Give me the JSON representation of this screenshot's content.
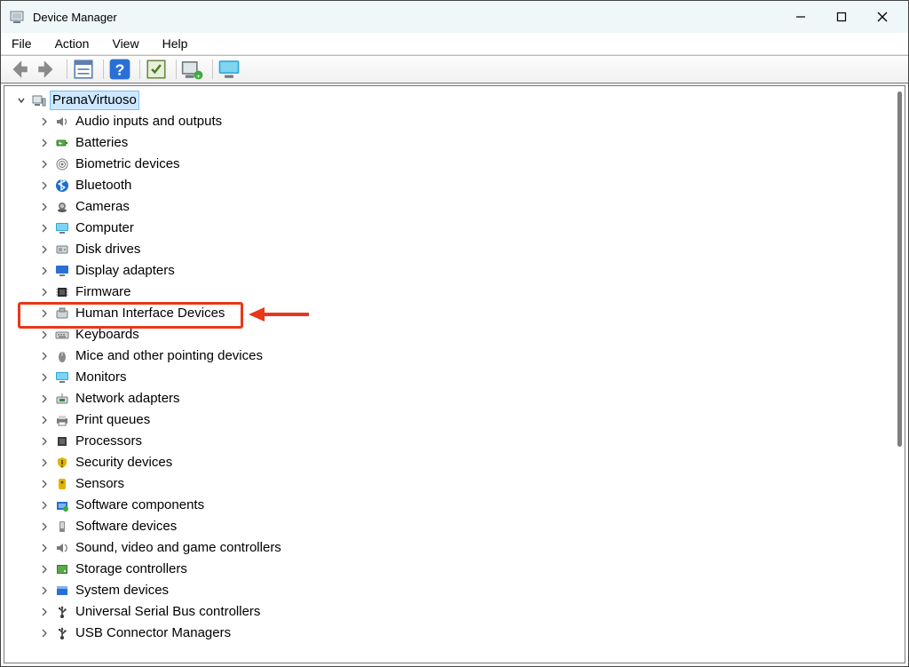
{
  "window": {
    "title": "Device Manager"
  },
  "menu": {
    "items": [
      "File",
      "Action",
      "View",
      "Help"
    ]
  },
  "toolbar": {
    "back": "Back",
    "forward": "Forward",
    "properties": "Properties",
    "help": "Help",
    "update": "Update",
    "scan": "Scan for hardware changes",
    "monitor": "Show hidden devices"
  },
  "tree": {
    "root": {
      "label": "PranaVirtuoso",
      "expanded": true,
      "selected": true
    },
    "categories": [
      {
        "label": "Audio inputs and outputs",
        "icon": "speaker"
      },
      {
        "label": "Batteries",
        "icon": "battery"
      },
      {
        "label": "Biometric devices",
        "icon": "fingerprint"
      },
      {
        "label": "Bluetooth",
        "icon": "bluetooth"
      },
      {
        "label": "Cameras",
        "icon": "camera"
      },
      {
        "label": "Computer",
        "icon": "monitor"
      },
      {
        "label": "Disk drives",
        "icon": "disk"
      },
      {
        "label": "Display adapters",
        "icon": "display"
      },
      {
        "label": "Firmware",
        "icon": "chip"
      },
      {
        "label": "Human Interface Devices",
        "icon": "hid",
        "highlighted": true
      },
      {
        "label": "Keyboards",
        "icon": "keyboard"
      },
      {
        "label": "Mice and other pointing devices",
        "icon": "mouse"
      },
      {
        "label": "Monitors",
        "icon": "monitor"
      },
      {
        "label": "Network adapters",
        "icon": "network"
      },
      {
        "label": "Print queues",
        "icon": "printer"
      },
      {
        "label": "Processors",
        "icon": "cpu"
      },
      {
        "label": "Security devices",
        "icon": "shield"
      },
      {
        "label": "Sensors",
        "icon": "sensor"
      },
      {
        "label": "Software components",
        "icon": "software"
      },
      {
        "label": "Software devices",
        "icon": "device"
      },
      {
        "label": "Sound, video and game controllers",
        "icon": "sound"
      },
      {
        "label": "Storage controllers",
        "icon": "storage"
      },
      {
        "label": "System devices",
        "icon": "system"
      },
      {
        "label": "Universal Serial Bus controllers",
        "icon": "usb"
      },
      {
        "label": "USB Connector Managers",
        "icon": "usb"
      }
    ]
  },
  "annotation": {
    "arrow_color": "#e8371a"
  }
}
